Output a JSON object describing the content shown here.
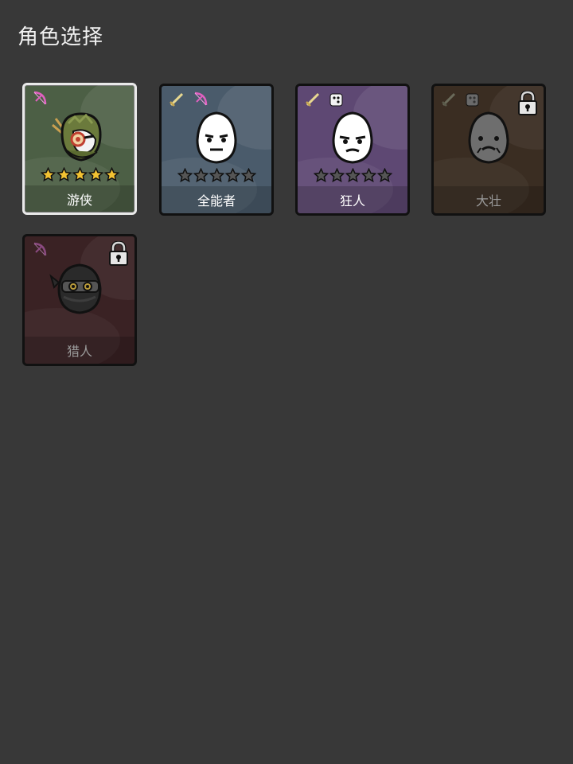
{
  "header": {
    "title": "角色选择"
  },
  "colors": {
    "page_bg": "#383838",
    "ranger_bg": "#4c5f45",
    "allrounder_bg": "#4a5b6b",
    "madman_bg": "#5e4873",
    "strongman_bg": "#3a2d22",
    "hunter_bg": "#3a2224",
    "star_filled": "#f2c232",
    "star_empty": "#555555",
    "selected_border": "#e9e9e9"
  },
  "characters": [
    {
      "name": "游侠",
      "selected": true,
      "locked": false,
      "stars_filled": 5,
      "stars_total": 5,
      "weapon_icons": [
        "bow-icon"
      ],
      "portrait_icon": "ranger-hooded-portrait-icon"
    },
    {
      "name": "全能者",
      "selected": false,
      "locked": false,
      "stars_filled": 0,
      "stars_total": 5,
      "weapon_icons": [
        "sword-icon",
        "bow-icon"
      ],
      "portrait_icon": "egg-face-portrait-icon"
    },
    {
      "name": "狂人",
      "selected": false,
      "locked": false,
      "stars_filled": 0,
      "stars_total": 5,
      "weapon_icons": [
        "sword-icon",
        "dice-icon"
      ],
      "portrait_icon": "egg-face-portrait-icon"
    },
    {
      "name": "大壮",
      "selected": false,
      "locked": true,
      "weapon_icons": [
        "sword-icon",
        "dice-icon"
      ],
      "portrait_icon": "egg-face-portrait-icon"
    },
    {
      "name": "猎人",
      "selected": false,
      "locked": true,
      "weapon_icons": [
        "bow-icon"
      ],
      "portrait_icon": "ninja-portrait-icon"
    }
  ]
}
